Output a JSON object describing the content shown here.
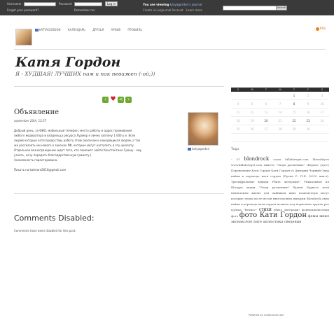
{
  "topbar": {
    "username_label": "Username",
    "password_label": "Password",
    "login_button": "Log in",
    "forgot_password": "Forgot your password?",
    "remember_me": "Remember me",
    "viewing_prefix": "You are viewing",
    "viewing_user": "katyagordon's journal",
    "create_account": "Create a LiveJournal Account",
    "learn_more": "Learn more",
    "search_button": "Search"
  },
  "nav": {
    "items": [
      "katyagordon",
      "Календарь",
      "Друзья",
      "Архив",
      "Профиль"
    ],
    "rss": "RSS"
  },
  "journal": {
    "title": "Катя Гордон",
    "subtitle": "Я - ХУДШАЯ! ЛУЧШИХ нам и пак неважен (-ой;))"
  },
  "entry": {
    "title": "Объявление",
    "date": "september 20th, 12:57",
    "body": [
      "Добрый день, за ФИО, мобильный телефон, место работы и адрес проживания",
      "любого модератора и владельца ресурса Лурмор я лично заплачу 1 000 у.е. Всех",
      "людей которые хотя предоставь работу этим сволочам и находящихся людям, а так",
      "же рассказать им нового о законах РФ, которые могут наступить в эту школоту.",
      "Отдельное вознаграждение ждет того, кто поможет найти Константина Грошу - ему",
      "узнать, хочу передать благодарственную грамоту.)",
      "Анонимность гарантирована."
    ],
    "contact": "Писать на katmore2010@gmail.com",
    "userpic_name": "katyagordon"
  },
  "comments": {
    "title": "Comments Disabled:",
    "text": "Comments have been disabled for this post."
  },
  "calendar": {
    "month_label": "",
    "weekdays": [
      "S",
      "M",
      "T",
      "W",
      "T",
      "F",
      "S"
    ],
    "rows": [
      [
        "",
        "",
        "",
        "",
        "1",
        "2",
        "3"
      ],
      [
        "4",
        "5",
        "6",
        "7",
        "8",
        "9",
        "10"
      ],
      [
        "11",
        "12",
        "13",
        "14",
        "15",
        "16",
        "17"
      ],
      [
        "18",
        "19",
        "20",
        "21",
        "22",
        "23",
        "24"
      ],
      [
        "25",
        "26",
        "27",
        "28",
        "29",
        "30",
        ""
      ],
      [
        "",
        "",
        "",
        "",
        "",
        "",
        ""
      ]
    ],
    "active_days": [
      "1",
      "8",
      "20",
      "22",
      "23"
    ]
  },
  "tags": {
    "heading": "Tags",
    "text_1": "- 31",
    "tag_big_1": "blondrock",
    "text_2": "cossa killaforeget.com liberality.ru www.killaforeget.com Анкета \"Люди различные\" (Верное утро!) Переведение Катя Гордон Катя Гордон vs Дмитрий Черный Окер найки в переводе катя гордон (Путин Р. П-Б. (2010 янв-ч). Тратифральные вдвыди Убить литерами!! Уникальные ия Шатуря акция \"Люди различные\" будем) Бурвого ясен (минатьные жизнь для чайников кино компьютеры могут которые люды после весли многопольна выгруки Blondrock окер найки в переводе катя гордон поэкаха под нормально группа раз группа \"Вечнос\"",
    "tag_big_2": "стихи",
    "text_3": "убить литерами! фонномпалистики фото",
    "tag_big_3": "фото Кати Гордон",
    "text_4": "фемы мнил экснакселе лите аплюстика сведения"
  },
  "footer": {
    "powered": "Powered by LiveJournal.com"
  }
}
